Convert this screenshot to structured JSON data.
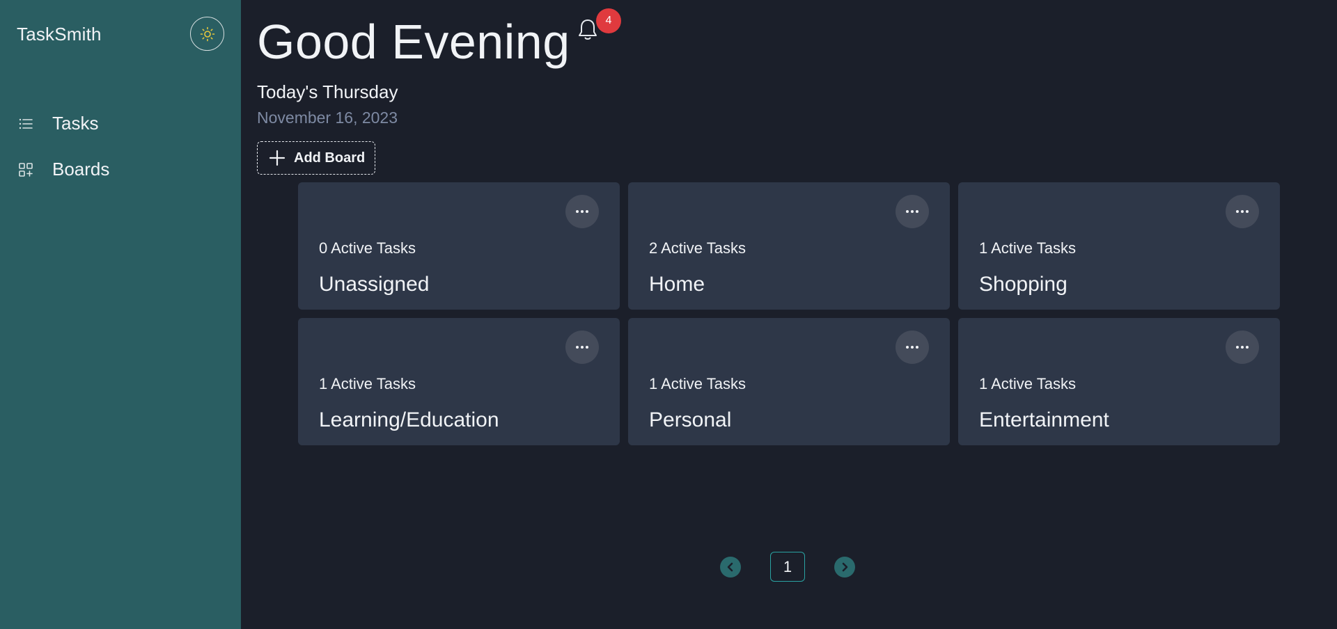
{
  "app": {
    "name": "TaskSmith"
  },
  "sidebar": {
    "theme_toggle_icon": "sun-icon",
    "items": [
      {
        "label": "Tasks",
        "icon": "list-icon"
      },
      {
        "label": "Boards",
        "icon": "grid-plus-icon"
      }
    ]
  },
  "header": {
    "greeting": "Good Evening",
    "notifications": {
      "count": "4",
      "icon": "bell-icon"
    },
    "day": "Today's Thursday",
    "date": "November 16, 2023"
  },
  "actions": {
    "add_board_label": "Add Board"
  },
  "boards": [
    {
      "count": "0 Active Tasks",
      "name": "Unassigned"
    },
    {
      "count": "2 Active Tasks",
      "name": "Home"
    },
    {
      "count": "1 Active Tasks",
      "name": "Shopping"
    },
    {
      "count": "1 Active Tasks",
      "name": "Learning/Education"
    },
    {
      "count": "1 Active Tasks",
      "name": "Personal"
    },
    {
      "count": "1 Active Tasks",
      "name": "Entertainment"
    }
  ],
  "pagination": {
    "current_page": "1"
  },
  "colors": {
    "sidebar_bg": "#2a5e62",
    "main_bg": "#1b1f2a",
    "card_bg": "#2e3748",
    "badge": "#e03a3e",
    "accent": "#2aa3a2",
    "sun": "#e8c93c"
  }
}
